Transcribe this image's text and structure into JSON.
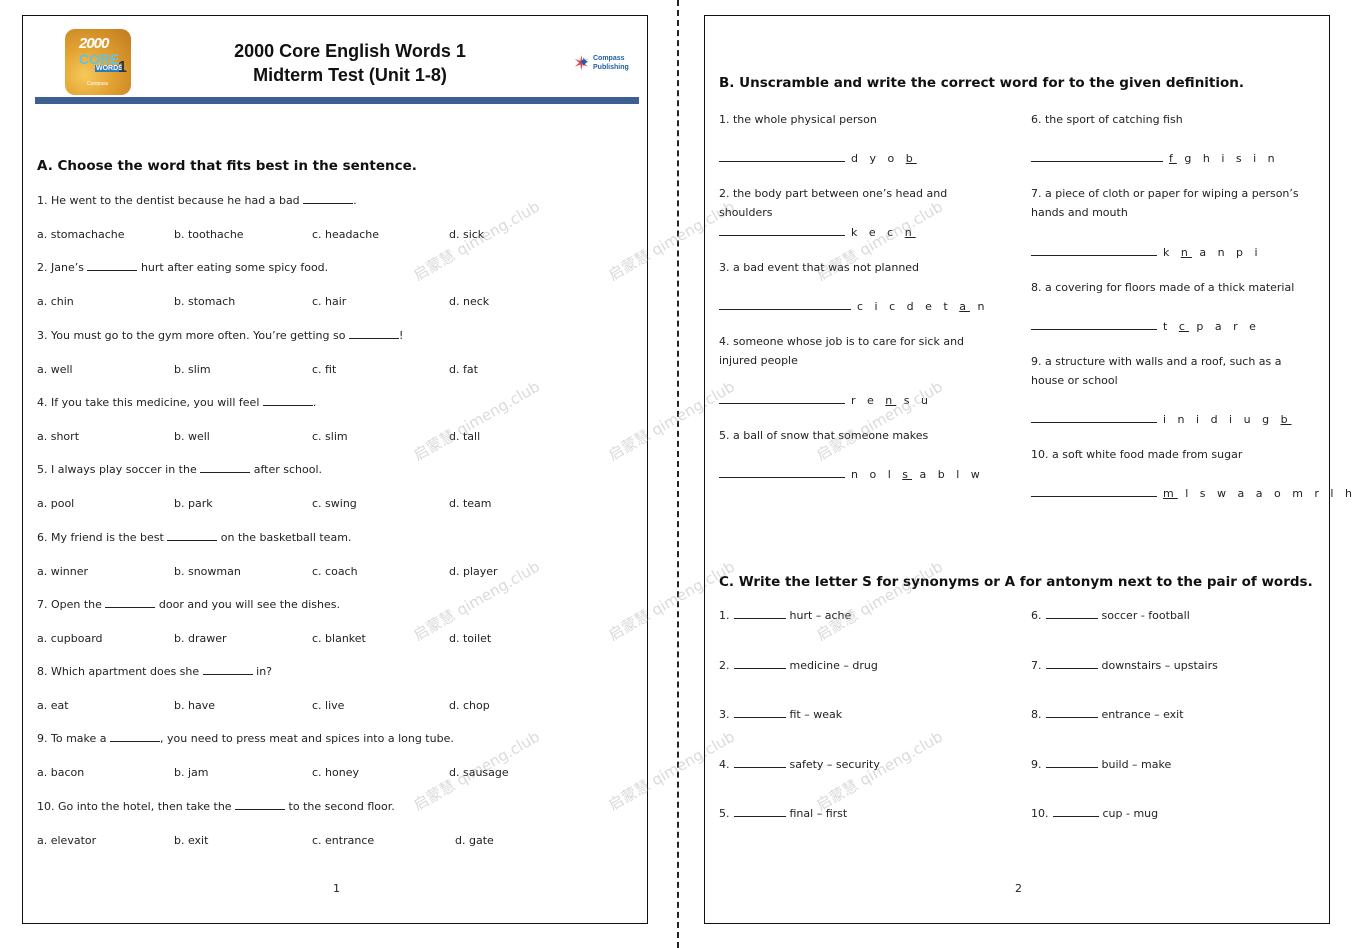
{
  "header": {
    "book_logo": {
      "line1": "2000",
      "line2": "CORE",
      "line3": "WORDS",
      "number": "1",
      "publisher": "Compass"
    },
    "title_line1": "2000 Core English Words 1",
    "title_line2": "Midterm Test (Unit 1-8)",
    "publisher_logo": {
      "line1": "Compass",
      "line2": "Publishing"
    }
  },
  "section_a": {
    "heading": "A. Choose the word that fits best in the sentence.",
    "questions": [
      {
        "pre": "1. He went to the dentist because he had a bad ",
        "post": ".",
        "options": [
          "a. stomachache",
          "b. toothache",
          "c. headache",
          "d. sick"
        ]
      },
      {
        "pre": "2. Jane’s ",
        "post": " hurt after eating some spicy food.",
        "options": [
          "a. chin",
          "b. stomach",
          "c. hair",
          "d. neck"
        ]
      },
      {
        "pre": "3. You must go to the gym more often. You’re getting so ",
        "post": "!",
        "options": [
          "a. well",
          "b. slim",
          "c. fit",
          "d. fat"
        ]
      },
      {
        "pre": "4. If you take this medicine, you will feel ",
        "post": ".",
        "options": [
          "a. short",
          "b. well",
          "c. slim",
          "d. tall"
        ]
      },
      {
        "pre": "5. I always play soccer in the ",
        "post": " after school.",
        "options": [
          "a. pool",
          "b. park",
          "c. swing",
          "d. team"
        ]
      },
      {
        "pre": "6. My friend is the best ",
        "post": " on the basketball team.",
        "options": [
          "a. winner",
          "b. snowman",
          "c. coach",
          "d. player"
        ]
      },
      {
        "pre": "7. Open the ",
        "post": " door and you will see the dishes.",
        "options": [
          "a. cupboard",
          "b. drawer",
          "c. blanket",
          "d. toilet"
        ]
      },
      {
        "pre": "8. Which apartment does she ",
        "post": " in?",
        "options": [
          "a. eat",
          "b. have",
          "c. live",
          "d. chop"
        ]
      },
      {
        "pre": "9. To make a ",
        "post": ", you need to press meat and spices into a long tube.",
        "options": [
          "a. bacon",
          "b. jam",
          "c. honey",
          "d. sausage"
        ]
      },
      {
        "pre": "10. Go into the hotel, then take the ",
        "post": " to the second floor.",
        "options": [
          "a. elevator",
          "b. exit",
          "c. entrance",
          "d. gate"
        ]
      }
    ],
    "page_number": "1"
  },
  "section_b": {
    "heading": "B. Unscramble and write the correct word for to the given definition.",
    "items": [
      {
        "definition": "1. the whole physical person",
        "scr_pre": "d y o ",
        "scr_u": "b",
        "scr_post": ""
      },
      {
        "definition": "2. the body part between one’s head and shoulders",
        "scr_pre": "k e c ",
        "scr_u": "n",
        "scr_post": ""
      },
      {
        "definition": "3. a bad event that was not planned",
        "scr_pre": "c i c d e t ",
        "scr_u": "a",
        "scr_post": " n"
      },
      {
        "definition": "4. someone whose job is to care for sick and injured people",
        "scr_pre": "r e ",
        "scr_u": "n",
        "scr_post": " s u"
      },
      {
        "definition": "5. a ball of snow that someone makes",
        "scr_pre": "n o l ",
        "scr_u": "s",
        "scr_post": " a b l w"
      },
      {
        "definition": "6. the sport of catching fish",
        "scr_pre": "",
        "scr_u": "f",
        "scr_post": " g h i s i n"
      },
      {
        "definition": "7. a piece of cloth or paper for wiping a person’s hands and mouth",
        "scr_pre": "k ",
        "scr_u": "n",
        "scr_post": " a n p i"
      },
      {
        "definition": "8. a covering for floors made of a thick material",
        "scr_pre": "t ",
        "scr_u": "c",
        "scr_post": " p a r e"
      },
      {
        "definition": "9. a structure with walls and a roof, such as a house or school",
        "scr_pre": "i n i d i u g ",
        "scr_u": "b",
        "scr_post": ""
      },
      {
        "definition": "10. a soft white food made from sugar",
        "scr_pre": "",
        "scr_u": "m",
        "scr_post": " l s w a a o m r l h"
      }
    ]
  },
  "section_c": {
    "heading": "C. Write the letter S for synonyms or A for antonym next to the pair of words.",
    "items": [
      {
        "num": "1.",
        "pair": "hurt – ache"
      },
      {
        "num": "2.",
        "pair": "medicine – drug"
      },
      {
        "num": "3.",
        "pair": "fit – weak"
      },
      {
        "num": "4.",
        "pair": "safety – security"
      },
      {
        "num": "5.",
        "pair": "final – first"
      },
      {
        "num": "6.",
        "pair": "soccer - football"
      },
      {
        "num": "7.",
        "pair": "downstairs – upstairs"
      },
      {
        "num": "8.",
        "pair": "entrance – exit"
      },
      {
        "num": "9.",
        "pair": "build – make"
      },
      {
        "num": "10.",
        "pair": "cup - mug"
      }
    ],
    "page_number": "2"
  },
  "watermark": {
    "cn": "启蒙慧",
    "en": "qimeng.club"
  }
}
